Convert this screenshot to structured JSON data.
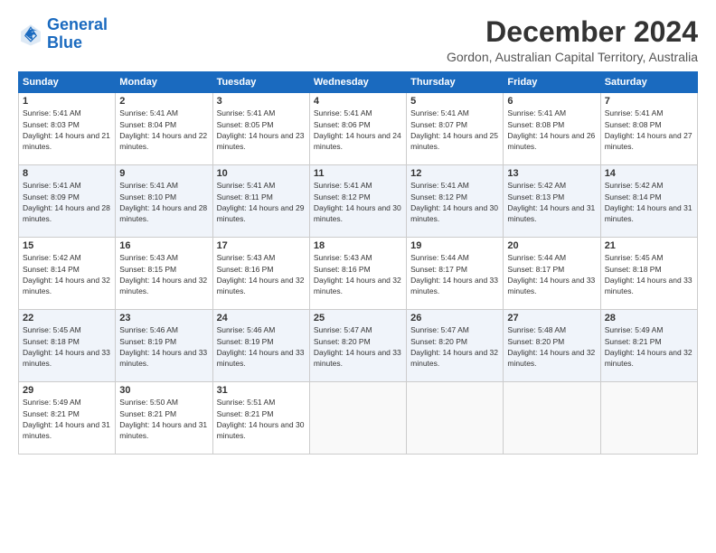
{
  "logo": {
    "line1": "General",
    "line2": "Blue"
  },
  "title": "December 2024",
  "subtitle": "Gordon, Australian Capital Territory, Australia",
  "weekdays": [
    "Sunday",
    "Monday",
    "Tuesday",
    "Wednesday",
    "Thursday",
    "Friday",
    "Saturday"
  ],
  "weeks": [
    [
      {
        "day": "1",
        "sunrise": "5:41 AM",
        "sunset": "8:03 PM",
        "daylight": "14 hours and 21 minutes."
      },
      {
        "day": "2",
        "sunrise": "5:41 AM",
        "sunset": "8:04 PM",
        "daylight": "14 hours and 22 minutes."
      },
      {
        "day": "3",
        "sunrise": "5:41 AM",
        "sunset": "8:05 PM",
        "daylight": "14 hours and 23 minutes."
      },
      {
        "day": "4",
        "sunrise": "5:41 AM",
        "sunset": "8:06 PM",
        "daylight": "14 hours and 24 minutes."
      },
      {
        "day": "5",
        "sunrise": "5:41 AM",
        "sunset": "8:07 PM",
        "daylight": "14 hours and 25 minutes."
      },
      {
        "day": "6",
        "sunrise": "5:41 AM",
        "sunset": "8:08 PM",
        "daylight": "14 hours and 26 minutes."
      },
      {
        "day": "7",
        "sunrise": "5:41 AM",
        "sunset": "8:08 PM",
        "daylight": "14 hours and 27 minutes."
      }
    ],
    [
      {
        "day": "8",
        "sunrise": "5:41 AM",
        "sunset": "8:09 PM",
        "daylight": "14 hours and 28 minutes."
      },
      {
        "day": "9",
        "sunrise": "5:41 AM",
        "sunset": "8:10 PM",
        "daylight": "14 hours and 28 minutes."
      },
      {
        "day": "10",
        "sunrise": "5:41 AM",
        "sunset": "8:11 PM",
        "daylight": "14 hours and 29 minutes."
      },
      {
        "day": "11",
        "sunrise": "5:41 AM",
        "sunset": "8:12 PM",
        "daylight": "14 hours and 30 minutes."
      },
      {
        "day": "12",
        "sunrise": "5:41 AM",
        "sunset": "8:12 PM",
        "daylight": "14 hours and 30 minutes."
      },
      {
        "day": "13",
        "sunrise": "5:42 AM",
        "sunset": "8:13 PM",
        "daylight": "14 hours and 31 minutes."
      },
      {
        "day": "14",
        "sunrise": "5:42 AM",
        "sunset": "8:14 PM",
        "daylight": "14 hours and 31 minutes."
      }
    ],
    [
      {
        "day": "15",
        "sunrise": "5:42 AM",
        "sunset": "8:14 PM",
        "daylight": "14 hours and 32 minutes."
      },
      {
        "day": "16",
        "sunrise": "5:43 AM",
        "sunset": "8:15 PM",
        "daylight": "14 hours and 32 minutes."
      },
      {
        "day": "17",
        "sunrise": "5:43 AM",
        "sunset": "8:16 PM",
        "daylight": "14 hours and 32 minutes."
      },
      {
        "day": "18",
        "sunrise": "5:43 AM",
        "sunset": "8:16 PM",
        "daylight": "14 hours and 32 minutes."
      },
      {
        "day": "19",
        "sunrise": "5:44 AM",
        "sunset": "8:17 PM",
        "daylight": "14 hours and 33 minutes."
      },
      {
        "day": "20",
        "sunrise": "5:44 AM",
        "sunset": "8:17 PM",
        "daylight": "14 hours and 33 minutes."
      },
      {
        "day": "21",
        "sunrise": "5:45 AM",
        "sunset": "8:18 PM",
        "daylight": "14 hours and 33 minutes."
      }
    ],
    [
      {
        "day": "22",
        "sunrise": "5:45 AM",
        "sunset": "8:18 PM",
        "daylight": "14 hours and 33 minutes."
      },
      {
        "day": "23",
        "sunrise": "5:46 AM",
        "sunset": "8:19 PM",
        "daylight": "14 hours and 33 minutes."
      },
      {
        "day": "24",
        "sunrise": "5:46 AM",
        "sunset": "8:19 PM",
        "daylight": "14 hours and 33 minutes."
      },
      {
        "day": "25",
        "sunrise": "5:47 AM",
        "sunset": "8:20 PM",
        "daylight": "14 hours and 33 minutes."
      },
      {
        "day": "26",
        "sunrise": "5:47 AM",
        "sunset": "8:20 PM",
        "daylight": "14 hours and 32 minutes."
      },
      {
        "day": "27",
        "sunrise": "5:48 AM",
        "sunset": "8:20 PM",
        "daylight": "14 hours and 32 minutes."
      },
      {
        "day": "28",
        "sunrise": "5:49 AM",
        "sunset": "8:21 PM",
        "daylight": "14 hours and 32 minutes."
      }
    ],
    [
      {
        "day": "29",
        "sunrise": "5:49 AM",
        "sunset": "8:21 PM",
        "daylight": "14 hours and 31 minutes."
      },
      {
        "day": "30",
        "sunrise": "5:50 AM",
        "sunset": "8:21 PM",
        "daylight": "14 hours and 31 minutes."
      },
      {
        "day": "31",
        "sunrise": "5:51 AM",
        "sunset": "8:21 PM",
        "daylight": "14 hours and 30 minutes."
      },
      null,
      null,
      null,
      null
    ]
  ]
}
